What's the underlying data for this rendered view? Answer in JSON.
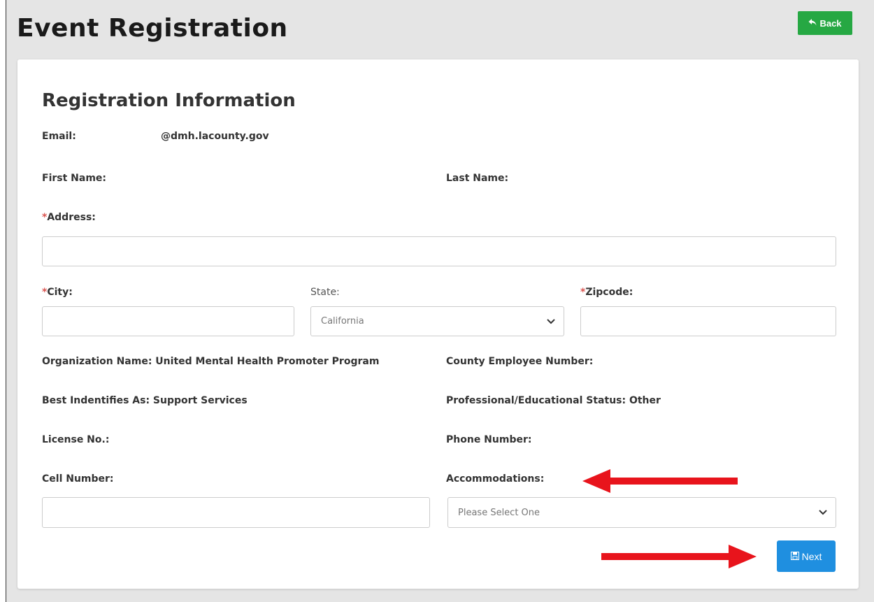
{
  "page": {
    "title": "Event Registration",
    "back_label": "Back"
  },
  "form": {
    "section_title": "Registration Information",
    "email_label": "Email:",
    "email_value": "@dmh.lacounty.gov",
    "first_name_label": "First Name:",
    "last_name_label": "Last Name:",
    "address": {
      "required_mark": "*",
      "label": "Address:",
      "value": ""
    },
    "city": {
      "required_mark": "*",
      "label": "City:",
      "value": ""
    },
    "state": {
      "label": "State:",
      "selected": "California"
    },
    "zipcode": {
      "required_mark": "*",
      "label": "Zipcode:",
      "value": ""
    },
    "organization_name": "Organization Name: United Mental Health Promoter Program",
    "county_employee_number": "County Employee Number:",
    "best_identifies_as": "Best Indentifies As: Support Services",
    "professional_status": "Professional/Educational Status: Other",
    "license_no": "License No.:",
    "phone_number": "Phone Number:",
    "cell_number": {
      "label": "Cell Number:",
      "value": ""
    },
    "accommodations": {
      "label": "Accommodations:",
      "selected": "Please Select One"
    },
    "next_label": "Next"
  },
  "colors": {
    "back_button": "#26a843",
    "next_button": "#1f8fe0",
    "required_mark": "#d9534f",
    "annotation_arrow": "#e8141c"
  },
  "icons": {
    "back": "reply-arrow-icon",
    "next": "save-disk-icon",
    "select": "chevron-down-icon"
  }
}
